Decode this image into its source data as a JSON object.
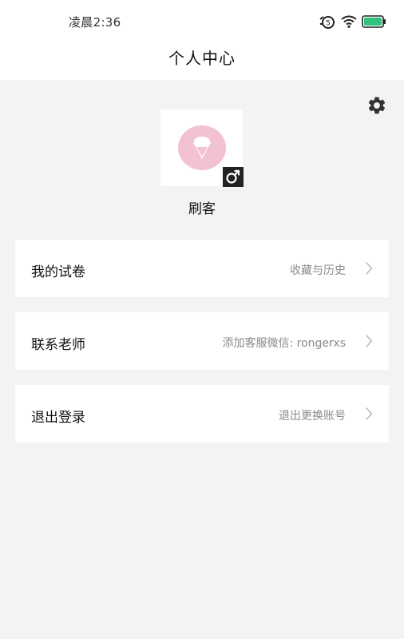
{
  "status_bar": {
    "time": "凌晨2:36",
    "alarm_badge": "5"
  },
  "header": {
    "title": "个人中心"
  },
  "profile": {
    "username": "刷客"
  },
  "menu": [
    {
      "label": "我的试卷",
      "subtitle": "收藏与历史"
    },
    {
      "label": "联系老师",
      "subtitle": "添加客服微信: rongerxs"
    },
    {
      "label": "退出登录",
      "subtitle": "退出更换账号"
    }
  ],
  "colors": {
    "battery": "#2ec27e",
    "avatar_bg": "#f2c1d4",
    "page_bg": "#f3f3f3"
  }
}
